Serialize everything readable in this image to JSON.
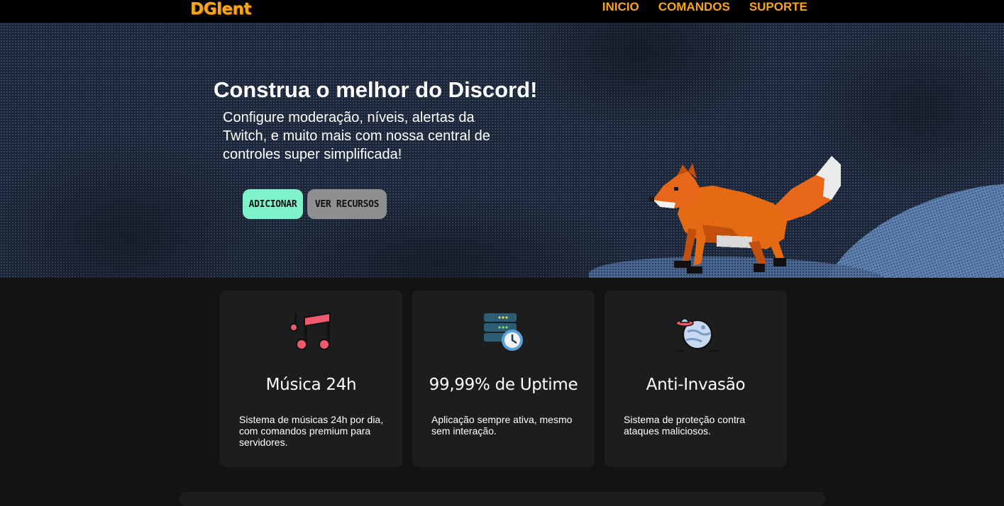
{
  "brand": {
    "logo_text": "DGlent"
  },
  "nav": {
    "items": [
      "INICIO",
      "COMANDOS",
      "SUPORTE"
    ]
  },
  "colors": {
    "accent": "#f7a51c",
    "add_button": "#7ff2cc",
    "resources_button": "#8f8f8f",
    "card_bg": "#1b1d1f",
    "page_bg": "#121413"
  },
  "hero": {
    "title": "Construa o melhor do Discord!",
    "description": "Configure moderação, níveis, alertas da Twitch, e muito mais com nossa central de controles super simplificada!",
    "add_button": "ADICIONAR",
    "resources_button": "VER RECURSOS",
    "illustration": "pixel-fox"
  },
  "features": [
    {
      "icon": "music-notes-icon",
      "title": "Música 24h",
      "text": "Sistema de músicas 24h por dia, com comandos premium para servidores."
    },
    {
      "icon": "server-clock-icon",
      "title": "99,99% de Uptime",
      "text": "Aplicação sempre ativa, mesmo sem interação."
    },
    {
      "icon": "planet-ufo-icon",
      "title": "Anti-Invasão",
      "text": "Sistema de proteção contra ataques maliciosos."
    }
  ]
}
